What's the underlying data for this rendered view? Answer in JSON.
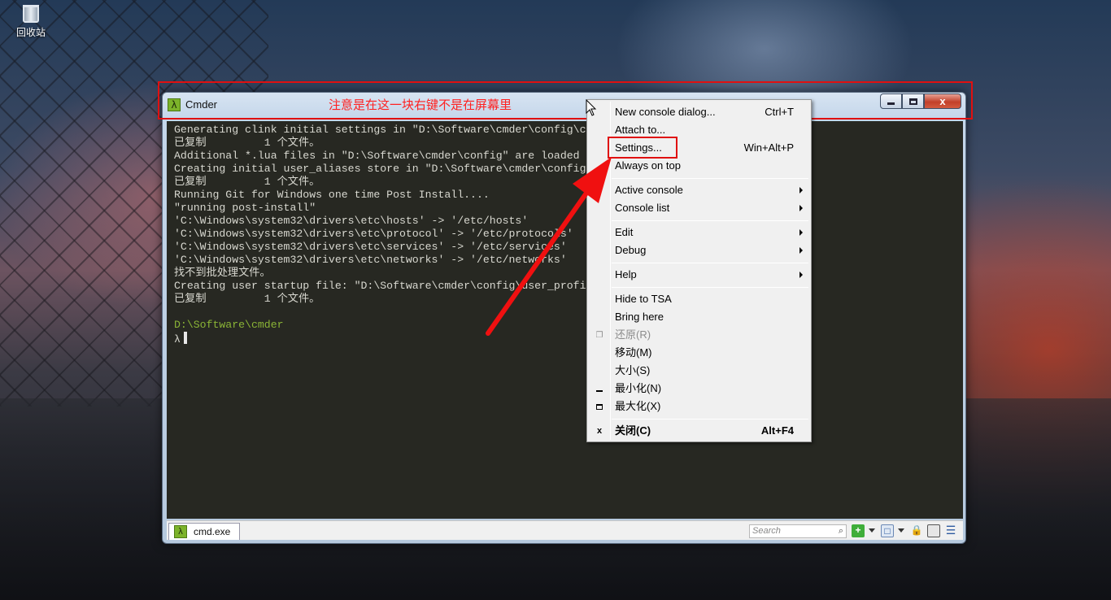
{
  "desktop": {
    "recycle_bin_label": "回收站"
  },
  "annotation": {
    "note": "注意是在这一块右键不是在屏幕里",
    "color": "#e01010"
  },
  "window": {
    "title": "Cmder",
    "app_icon_glyph": "λ",
    "close_glyph": "x"
  },
  "console": {
    "lines": [
      "Generating clink initial settings in \"D:\\Software\\cmder\\config\\c",
      "已复制         1 个文件。",
      "Additional *.lua files in \"D:\\Software\\cmder\\config\" are loaded",
      "Creating initial user_aliases store in \"D:\\Software\\cmder\\config",
      "已复制         1 个文件。",
      "Running Git for Windows one time Post Install....",
      "\"running post-install\"",
      "'C:\\Windows\\system32\\drivers\\etc\\hosts' -> '/etc/hosts'",
      "'C:\\Windows\\system32\\drivers\\etc\\protocol' -> '/etc/protocols'",
      "'C:\\Windows\\system32\\drivers\\etc\\services' -> '/etc/services'",
      "'C:\\Windows\\system32\\drivers\\etc\\networks' -> '/etc/networks'",
      "找不到批处理文件。",
      "Creating user startup file: \"D:\\Software\\cmder\\config\\user_profi",
      "已复制         1 个文件。",
      ""
    ],
    "prompt_path": "D:\\Software\\cmder",
    "prompt_symbol": "λ"
  },
  "statusbar": {
    "tab_label": "cmd.exe",
    "tab_icon_glyph": "λ",
    "search_placeholder": "Search"
  },
  "context_menu": {
    "items": [
      {
        "label": "New console dialog...",
        "shortcut": "Ctrl+T"
      },
      {
        "label": "Attach to..."
      },
      {
        "label": "Settings...",
        "shortcut": "Win+Alt+P"
      },
      {
        "label": "Always on top"
      },
      {
        "label": "Active console"
      },
      {
        "label": "Console list"
      },
      {
        "label": "Edit"
      },
      {
        "label": "Debug"
      },
      {
        "label": "Help"
      },
      {
        "label": "Hide to TSA"
      },
      {
        "label": "Bring here"
      },
      {
        "label": "还原(R)"
      },
      {
        "label": "移动(M)"
      },
      {
        "label": "大小(S)"
      },
      {
        "label": "最小化(N)"
      },
      {
        "label": "最大化(X)"
      },
      {
        "label": "关闭(C)",
        "shortcut": "Alt+F4"
      }
    ],
    "restore_icon": "restore-icon",
    "minimize_icon": "minimize-icon",
    "maximize_icon": "maximize-icon",
    "close_icon_glyph": "x"
  },
  "colors": {
    "console_bg": "#272822",
    "prompt_green": "#8ab436",
    "annotation_red": "#e01010"
  }
}
